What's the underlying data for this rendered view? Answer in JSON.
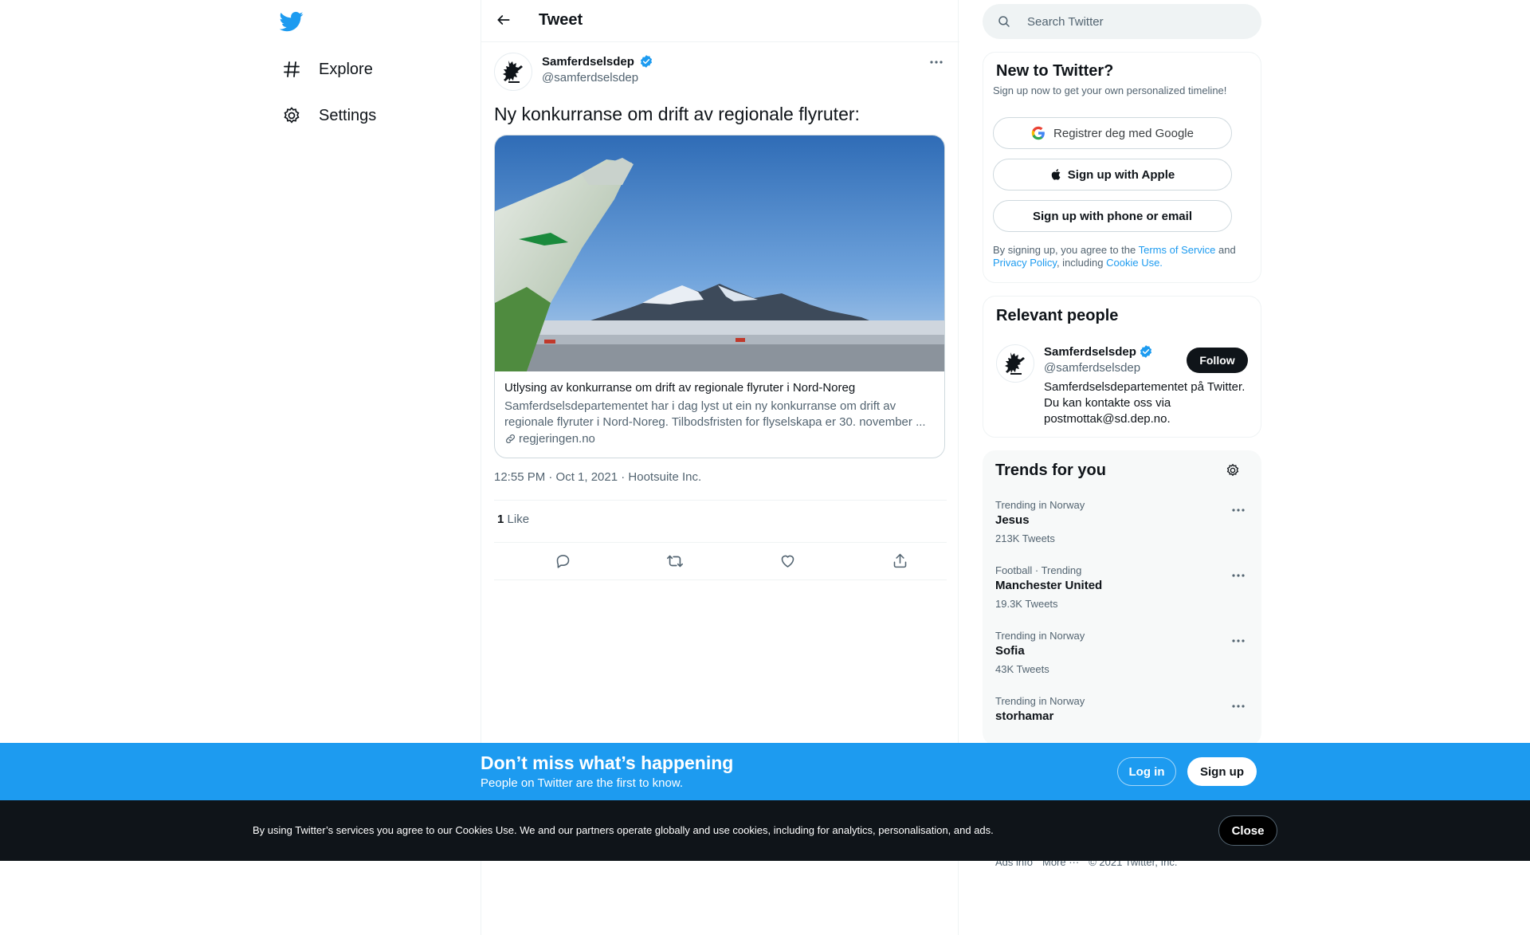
{
  "nav": {
    "explore_label": "Explore",
    "settings_label": "Settings"
  },
  "header": {
    "title": "Tweet"
  },
  "tweet": {
    "author_name": "Samferdselsdep",
    "author_handle": "@samferdselsdep",
    "text": "Ny konkurranse om drift av regionale flyruter:",
    "card": {
      "title": "Utlysing av konkurranse om drift av regionale flyruter i Nord-Noreg",
      "description": "Samferdselsdepartementet har i dag lyst ut ein ny konkurranse om drift av regionale flyruter i Nord-Noreg. Tilbodsfristen for flyselskapa er 30. november ...",
      "domain": "regjeringen.no"
    },
    "meta": "12:55 PM · Oct 1, 2021 · Hootsuite Inc.",
    "like_count": "1",
    "like_label": "Like"
  },
  "search": {
    "placeholder": "Search Twitter"
  },
  "new_to_twitter": {
    "title": "New to Twitter?",
    "subtitle": "Sign up now to get your own personalized timeline!",
    "google_label": "Registrer deg med Google",
    "apple_label": "Sign up with Apple",
    "phone_label": "Sign up with phone or email",
    "terms_prefix": "By signing up, you agree to the ",
    "terms_link": "Terms of Service",
    "terms_and": " and ",
    "privacy_link": "Privacy Policy",
    "terms_including": ", including ",
    "cookie_link": "Cookie Use."
  },
  "relevant_people": {
    "title": "Relevant people",
    "name": "Samferdselsdep",
    "handle": "@samferdselsdep",
    "bio": "Samferdselsdepartementet på Twitter. Du kan kontakte oss via postmottak@sd.dep.no.",
    "follow_label": "Follow"
  },
  "trends": {
    "title": "Trends for you",
    "items": [
      {
        "context": "Trending in Norway",
        "name": "Jesus",
        "count": "213K Tweets"
      },
      {
        "context": "Football · Trending",
        "name": "Manchester United",
        "count": "19.3K Tweets"
      },
      {
        "context": "Trending in Norway",
        "name": "Sofia",
        "count": "43K Tweets"
      },
      {
        "context": "Trending in Norway",
        "name": "storhamar",
        "count": ""
      }
    ]
  },
  "footer": {
    "ads_info": "Ads info",
    "more": "More ···",
    "copyright": "© 2021 Twitter, Inc."
  },
  "signup_bar": {
    "title": "Don’t miss what’s happening",
    "subtitle": "People on Twitter are the first to know.",
    "login_label": "Log in",
    "signup_label": "Sign up"
  },
  "cookie_bar": {
    "text": "By using Twitter’s services you agree to our Cookies Use. We and our partners operate globally and use cookies, including for analytics, personalisation, and ads.",
    "close_label": "Close"
  },
  "colors": {
    "brand_blue": "#1d9bf0",
    "text_primary": "#0f1419",
    "text_secondary": "#536471",
    "cookie_bg": "#0f1419"
  },
  "icons": [
    "twitter-logo-icon",
    "hashtag-icon",
    "gear-icon",
    "back-arrow-icon",
    "verified-badge-icon",
    "more-icon",
    "link-icon",
    "reply-icon",
    "retweet-icon",
    "like-icon",
    "share-icon",
    "search-icon",
    "google-icon",
    "apple-icon"
  ]
}
